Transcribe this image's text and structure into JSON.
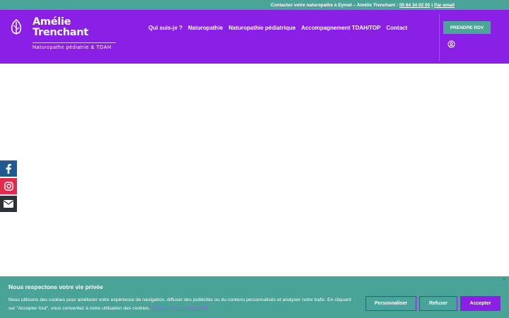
{
  "topbar": {
    "text": "Contactez votre naturopathe à Eymet – Amélie Trenchant : ",
    "phone": "05 64 34 02 00",
    "separator": " | ",
    "email_link": "Par email"
  },
  "header": {
    "brand_line1": "Amélie",
    "brand_line2": "Trenchant",
    "tagline": "Naturopathe pédiatrie & TDAH",
    "nav": [
      {
        "label": "Qui suis-je ?"
      },
      {
        "label": "Naturopathie"
      },
      {
        "label": "Naturopathie pédiatrique"
      },
      {
        "label": "Accompagnement TDAH/TOP"
      },
      {
        "label": "Contact"
      }
    ],
    "cta": "PRENDRE RDV"
  },
  "social": [
    "facebook-icon",
    "instagram-icon",
    "mail-icon"
  ],
  "cookie": {
    "title": "Nous respectons votre vie privée",
    "text": "Nous utilisons des cookies pour améliorer votre expérience de navigation, diffuser des publicités ou du contenu personnalisés et analyser notre trafic. En cliquant sur \"Accepter tout\", vous consentez à notre utilisation des cookies. ",
    "policy_link": "Politique de confidentialité",
    "customize": "Personnaliser",
    "refuse": "Refuser",
    "accept": "Accepter"
  },
  "colors": {
    "brand_purple": "#8a1fe6",
    "teal": "#4aa598"
  }
}
